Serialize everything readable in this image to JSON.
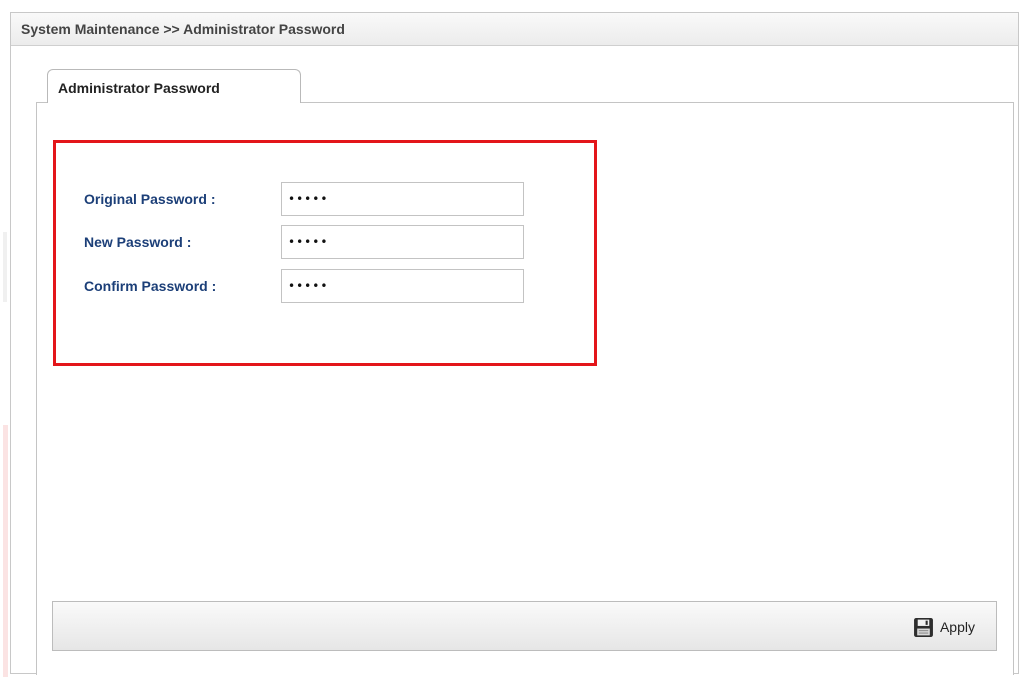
{
  "breadcrumb": "System Maintenance >> Administrator Password",
  "tabs": [
    {
      "label": "Administrator Password",
      "active": true
    }
  ],
  "form": {
    "original_label": "Original Password :",
    "original_value": "•••••",
    "new_label": "New Password :",
    "new_value": "•••••",
    "confirm_label": "Confirm Password :",
    "confirm_value": "•••••"
  },
  "actions": {
    "apply_label": "Apply",
    "apply_icon": "save-icon"
  },
  "colors": {
    "label": "#1c3f78",
    "highlight": "#e3161a"
  }
}
